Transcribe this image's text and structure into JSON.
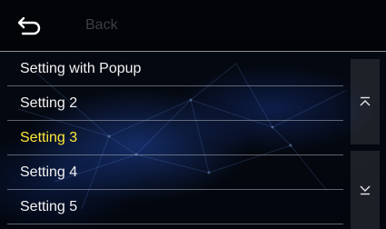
{
  "header": {
    "back_label": "Back",
    "back_icon": "return-arrow-icon"
  },
  "settings": {
    "items": [
      {
        "label": "Setting with Popup"
      },
      {
        "label": "Setting 2"
      },
      {
        "label": "Setting 3"
      },
      {
        "label": "Setting 4"
      },
      {
        "label": "Setting 5"
      }
    ],
    "selected_index": 2
  },
  "scroll": {
    "up_icon": "scroll-to-top-icon",
    "down_icon": "scroll-to-bottom-icon"
  },
  "colors": {
    "text": "#f2f2f2",
    "selected_text": "#ffe83a",
    "back_label": "#3c3f45",
    "divider": "#8b8f96"
  }
}
